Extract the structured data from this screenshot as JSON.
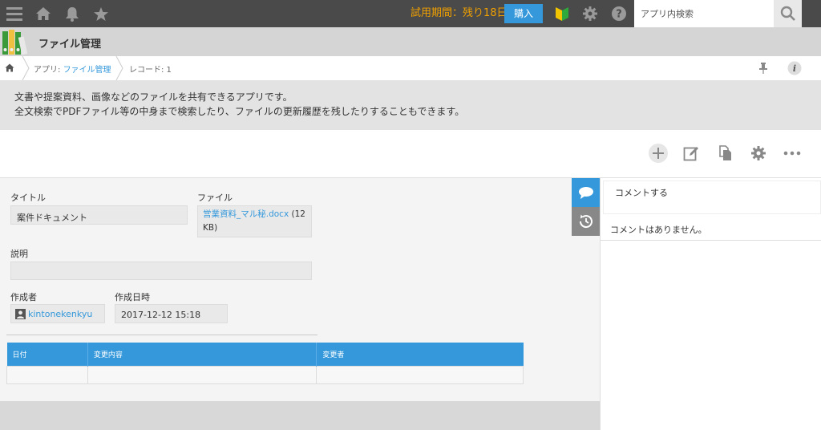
{
  "topbar": {
    "trial_text": "試用期間：残り18日",
    "buy_label": "購入",
    "search_placeholder": "アプリ内検索"
  },
  "app": {
    "title": "ファイル管理"
  },
  "breadcrumb": {
    "app_prefix": "アプリ:",
    "app_name": "ファイル管理",
    "record": "レコード: 1"
  },
  "description": {
    "line1": "文書や提案資料、画像などのファイルを共有できるアプリです。",
    "line2": "全文検索でPDFファイル等の中身まで検索したり、ファイルの更新履歴を残したりすることもできます。"
  },
  "record": {
    "title_label": "タイトル",
    "title_value": "案件ドキュメント",
    "file_label": "ファイル",
    "file_name": "営業資料_マル秘.docx",
    "file_size": "(12 KB)",
    "desc_label": "説明",
    "desc_value": "",
    "creator_label": "作成者",
    "creator_value": "kintonekenkyu",
    "created_label": "作成日時",
    "created_value": "2017-12-12 15:18"
  },
  "history_table": {
    "headers": [
      "日付",
      "変更内容",
      "変更者"
    ]
  },
  "comments": {
    "input_placeholder": "コメントする",
    "empty_text": "コメントはありません。"
  },
  "colors": {
    "topbar": "#4a4a4a",
    "accent": "#3498db",
    "trial": "#f0a000"
  }
}
